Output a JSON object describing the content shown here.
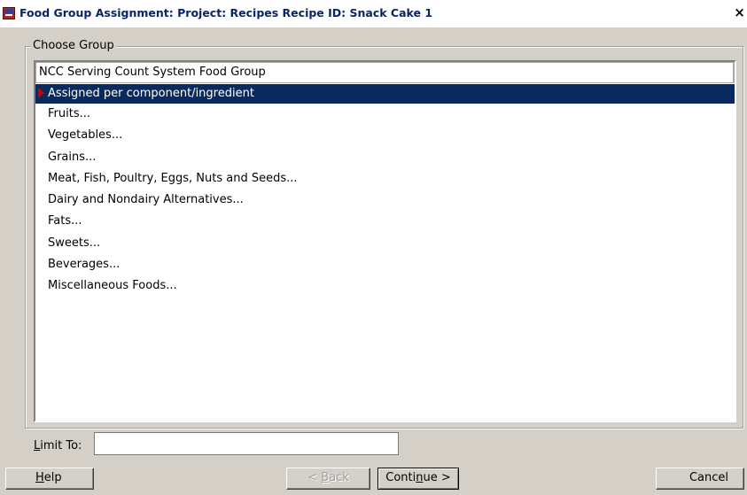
{
  "window": {
    "title": "Food Group Assignment: Project: Recipes Recipe ID: Snack Cake 1",
    "icon": "ndsr-app-icon",
    "close_glyph": "×"
  },
  "group": {
    "label": "Choose Group",
    "column_header": "NCC Serving Count System Food Group",
    "items": [
      "Assigned per component/ingredient",
      "Fruits...",
      "Vegetables...",
      "Grains...",
      "Meat, Fish, Poultry, Eggs, Nuts and Seeds...",
      "Dairy and Nondairy Alternatives...",
      "Fats...",
      "Sweets...",
      "Beverages...",
      "Miscellaneous Foods..."
    ],
    "selected_index": 0
  },
  "limit": {
    "label_accel": "L",
    "label_rest": "imit To:",
    "value": "",
    "placeholder": ""
  },
  "buttons": {
    "help_accel": "H",
    "help_rest": "elp",
    "back_prefix": "< ",
    "back_accel": "B",
    "back_rest": "ack",
    "continue_pre": "Conti",
    "continue_accel": "n",
    "continue_rest": "ue >",
    "cancel": "Cancel"
  },
  "colors": {
    "selection": "#0a2a5e",
    "title_text": "#0a246a",
    "row_marker": "#c80000",
    "dialog_face": "#d4d0c8"
  }
}
